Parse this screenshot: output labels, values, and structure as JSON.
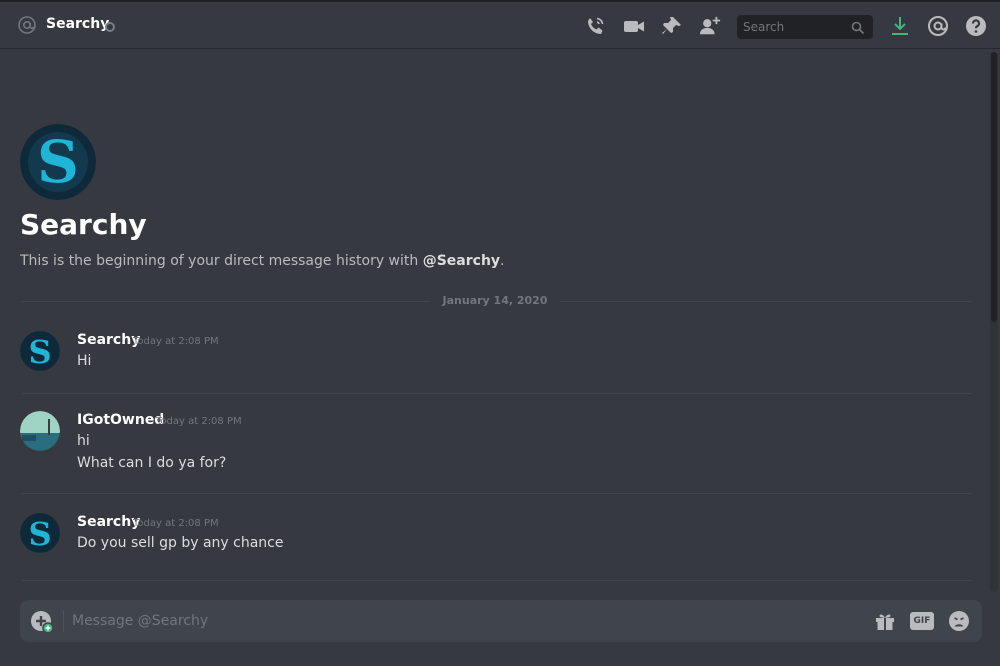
{
  "header": {
    "channel_name": "Searchy",
    "search_placeholder": "Search",
    "icons": [
      "at-icon",
      "call-icon",
      "video-icon",
      "pin-icon",
      "add-friend-icon",
      "search-icon",
      "download-icon",
      "mention-icon",
      "help-icon"
    ]
  },
  "intro": {
    "title": "Searchy",
    "text_prefix": "This is the beginning of your direct message history with ",
    "mention": "@Searchy",
    "text_suffix": "."
  },
  "date_divider": "January 14, 2020",
  "messages": [
    {
      "author": "Searchy",
      "time": "Today at 2:08 PM",
      "lines": [
        "Hi"
      ]
    },
    {
      "author": "IGotOwned",
      "time": "Today at 2:08 PM",
      "lines": [
        "hi",
        "What can I do ya for?"
      ]
    },
    {
      "author": "Searchy",
      "time": "Today at 2:08 PM",
      "lines": [
        "Do you sell gp by any chance"
      ]
    }
  ],
  "composer": {
    "placeholder": "Message @Searchy",
    "gif_label": "GIF"
  },
  "colors": {
    "background": "#36393f",
    "input_bg": "#40444b",
    "accent_green": "#43b581",
    "searchy_teal": "#1fb5d6"
  }
}
